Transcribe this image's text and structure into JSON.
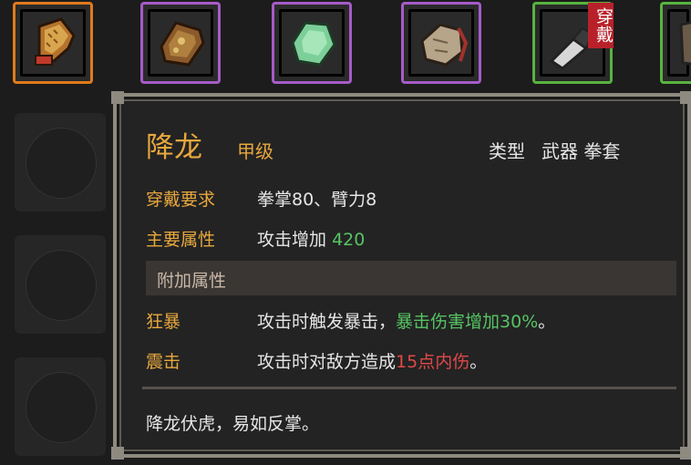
{
  "slots": [
    {
      "name": "gauntlet-slot",
      "rarity": "orange",
      "icon": "gauntlet-icon"
    },
    {
      "name": "armor-slot",
      "rarity": "purple",
      "icon": "armor-icon"
    },
    {
      "name": "jade-slot",
      "rarity": "purple",
      "icon": "jade-stone-icon"
    },
    {
      "name": "pouch-slot",
      "rarity": "purple",
      "icon": "pouch-icon"
    },
    {
      "name": "cleaver-slot",
      "rarity": "green",
      "icon": "cleaver-icon",
      "tag": "穿戴"
    },
    {
      "name": "partial-slot",
      "rarity": "green",
      "icon": "unknown-icon"
    }
  ],
  "tooltip": {
    "name": "降龙",
    "grade": "甲级",
    "type_label": "类型",
    "type_value": "武器 拳套",
    "requirement_label": "穿戴要求",
    "requirement_value": "拳掌80、臂力8",
    "main_attr_label": "主要属性",
    "main_attr_text": "攻击增加",
    "main_attr_value": "420",
    "extra_header": "附加属性",
    "extras": [
      {
        "name": "狂暴",
        "desc_prefix": "攻击时触发暴击，",
        "desc_highlight": "暴击伤害增加30%",
        "desc_suffix": "。",
        "highlight_color": "#56c464"
      },
      {
        "name": "震击",
        "desc_prefix": "攻击时对敌方造成",
        "desc_highlight": "15点内伤",
        "desc_suffix": "。",
        "highlight_color": "#e04848"
      }
    ],
    "flavor": "降龙伏虎，易如反掌。"
  },
  "colors": {
    "orange": "#e07a1c",
    "purple": "#a65bc8",
    "green": "#57b33f",
    "gold": "#e8a83d"
  }
}
